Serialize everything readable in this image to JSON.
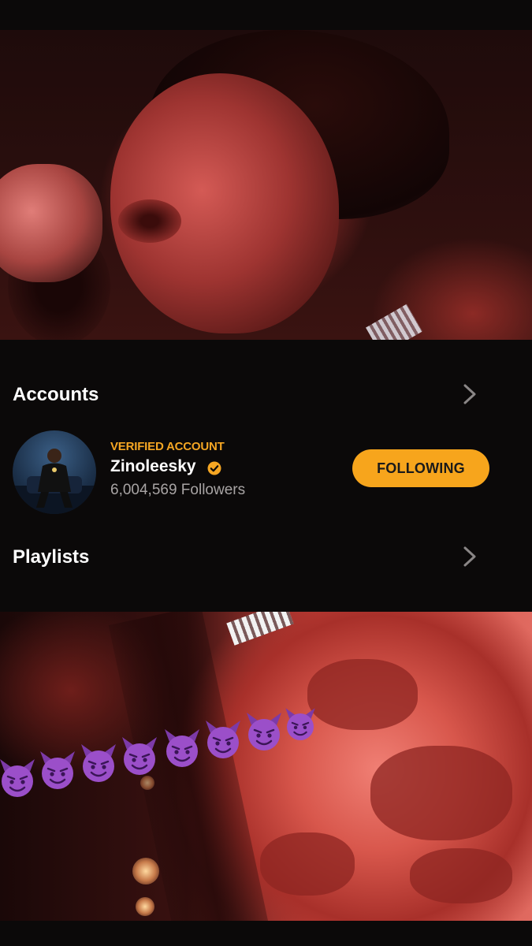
{
  "accounts": {
    "section_title": "Accounts",
    "item": {
      "label": "VERIFIED ACCOUNT",
      "name": "Zinoleesky",
      "followers": "6,004,569 Followers",
      "button": "FOLLOWING"
    }
  },
  "playlists": {
    "section_title": "Playlists"
  },
  "icons": {
    "chevron": "chevron-right-icon",
    "verified": "verified-check-icon",
    "emoji": "smiling-devil-emoji"
  },
  "colors": {
    "accent": "#f7a51c",
    "verified_label": "#f5a623",
    "background": "#0b0909",
    "secondary_text": "#a8a4a4",
    "emoji_purple": "#9b4fc9"
  }
}
